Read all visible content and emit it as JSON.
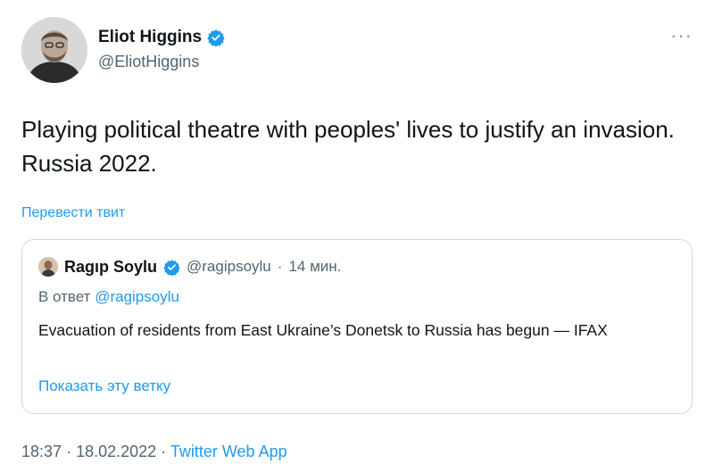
{
  "author": {
    "name": "Eliot Higgins",
    "handle": "@EliotHiggins",
    "verified_icon": "verified-badge-icon"
  },
  "more_icon": "more-horizontal-icon",
  "more_label": "···",
  "tweet_text": "Playing political theatre with peoples' lives to justify an invasion. Russia 2022.",
  "translate_link": "Перевести твит",
  "quoted_tweet": {
    "name": "Ragıp Soylu",
    "handle": "@ragipsoylu",
    "separator": "·",
    "time": "14 мин.",
    "reply_prefix": "В ответ",
    "reply_mention": "@ragipsoylu",
    "text": "Evacuation of residents from East Ukraine’s Donetsk to Russia has begun — IFAX",
    "show_thread": "Показать эту ветку"
  },
  "meta": {
    "time": "18:37",
    "sep1": "·",
    "date": "18.02.2022",
    "sep2": "·",
    "app": "Twitter Web App"
  },
  "colors": {
    "link": "#1d9bf0",
    "secondary_text": "#536471",
    "primary_text": "#0f1419",
    "border": "#cfd9de"
  }
}
